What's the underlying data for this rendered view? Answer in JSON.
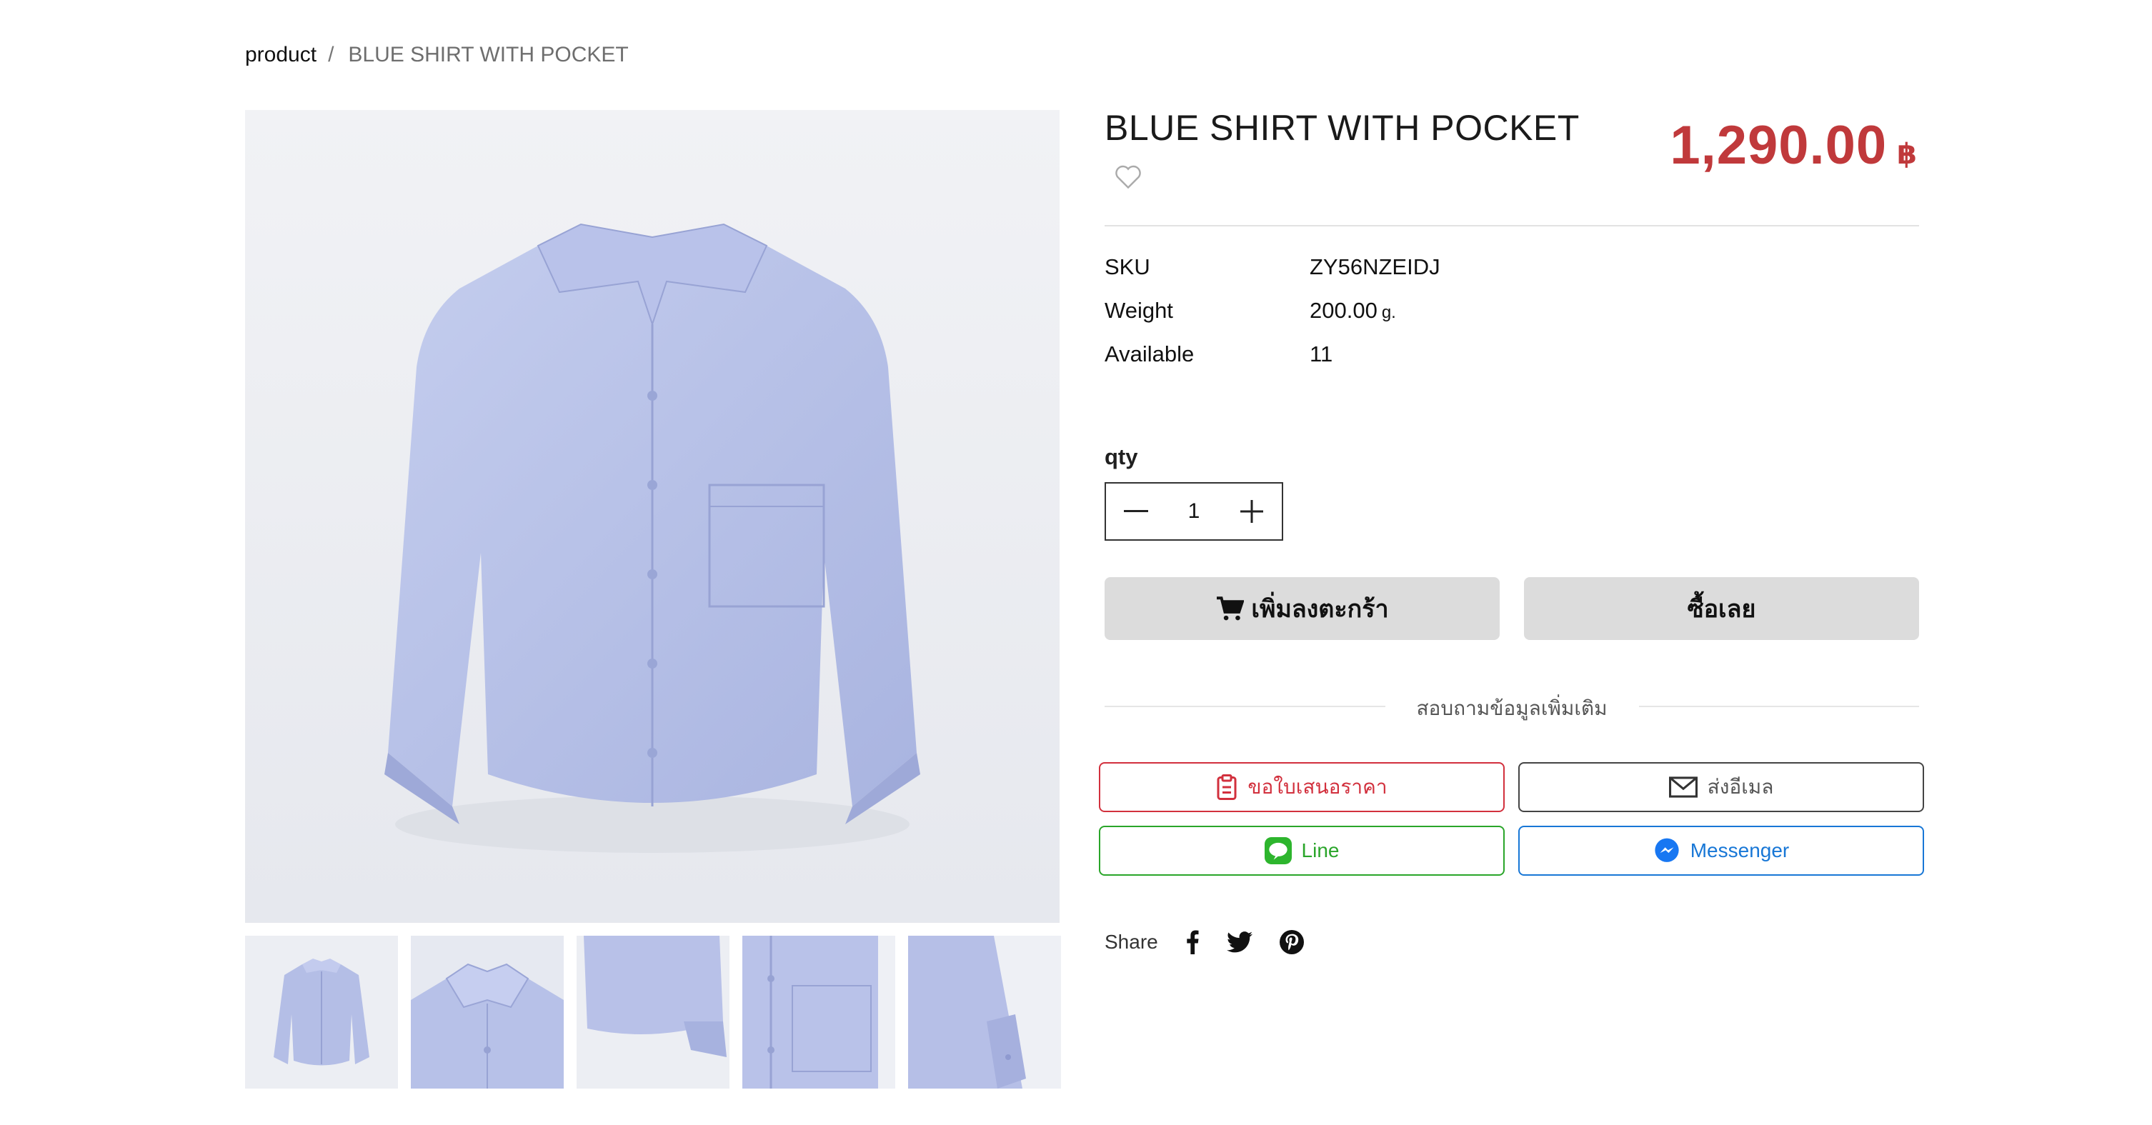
{
  "breadcrumb": {
    "link": "product",
    "separator": "/",
    "current": "BLUE SHIRT WITH POCKET"
  },
  "product": {
    "title": "BLUE SHIRT WITH POCKET",
    "price": "1,290.00",
    "currency": "฿",
    "price_color": "#c0393b",
    "image_subject": "light blue long-sleeve shirt with chest pocket"
  },
  "specs": {
    "sku_label": "SKU",
    "sku_value": "ZY56NZEIDJ",
    "weight_label": "Weight",
    "weight_value": "200.00",
    "weight_unit": "g.",
    "available_label": "Available",
    "available_value": "11"
  },
  "quantity": {
    "label": "qty",
    "value": "1"
  },
  "actions": {
    "add_to_cart": "เพิ่มลงตะกร้า",
    "buy_now": "ซื้อเลย"
  },
  "inquiry": {
    "heading": "สอบถามข้อมูลเพิ่มเติม",
    "quote": "ขอใบเสนอราคา",
    "email": "ส่งอีเมล",
    "line": "Line",
    "messenger": "Messenger",
    "colors": {
      "quote": "#d2303d",
      "email": "#444444",
      "line": "#2aa52a",
      "messenger": "#1877d6"
    }
  },
  "share": {
    "label": "Share",
    "icons": [
      "facebook-icon",
      "twitter-icon",
      "pinterest-icon"
    ]
  },
  "thumbnails": [
    "shirt-front",
    "collar-detail",
    "hem-detail",
    "pocket-detail",
    "cuff-detail"
  ]
}
